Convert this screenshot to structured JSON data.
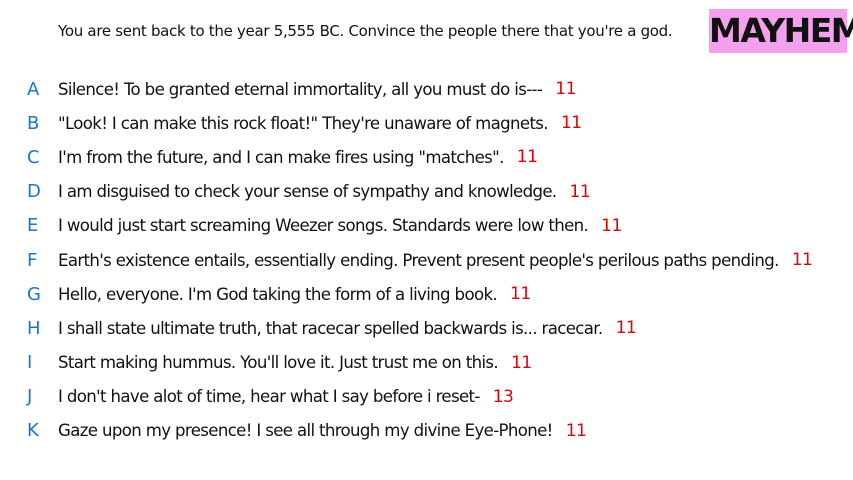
{
  "prompt": "You are sent back to the year 5,555 BC. Convince the people there that you're a god.",
  "badge": {
    "label": "MAYHEM",
    "color": "#f5a0ee"
  },
  "colors": {
    "letter": "#1a73d9",
    "score": "#e0000a",
    "text": "#111111"
  },
  "answers": [
    {
      "letter": "A",
      "text": "Silence! To be granted eternal immortality, all you must do is---",
      "score": "11"
    },
    {
      "letter": "B",
      "text": "\"Look! I can make this rock float!\" They're unaware of magnets.",
      "score": "11"
    },
    {
      "letter": "C",
      "text": "I'm from the future, and I can make fires using \"matches\".",
      "score": "11"
    },
    {
      "letter": "D",
      "text": "I am disguised to check your sense of sympathy and knowledge.",
      "score": "11"
    },
    {
      "letter": "E",
      "text": "I would just start screaming Weezer songs. Standards were low then.",
      "score": "11"
    },
    {
      "letter": "F",
      "text": "Earth's existence entails, essentially ending. Prevent present people's perilous paths pending.",
      "score": "11"
    },
    {
      "letter": "G",
      "text": "Hello, everyone. I'm God taking the form of a living book.",
      "score": "11"
    },
    {
      "letter": "H",
      "text": "I shall state ultimate truth, that racecar spelled backwards is... racecar.",
      "score": "11"
    },
    {
      "letter": "I",
      "text": "Start making hummus. You'll love it. Just trust me on this.",
      "score": "11"
    },
    {
      "letter": "J",
      "text": "I don't have alot of time, hear what I say before i reset-",
      "score": "13"
    },
    {
      "letter": "K",
      "text": "Gaze upon my presence! I see all through my divine Eye-Phone!",
      "score": "11"
    }
  ]
}
